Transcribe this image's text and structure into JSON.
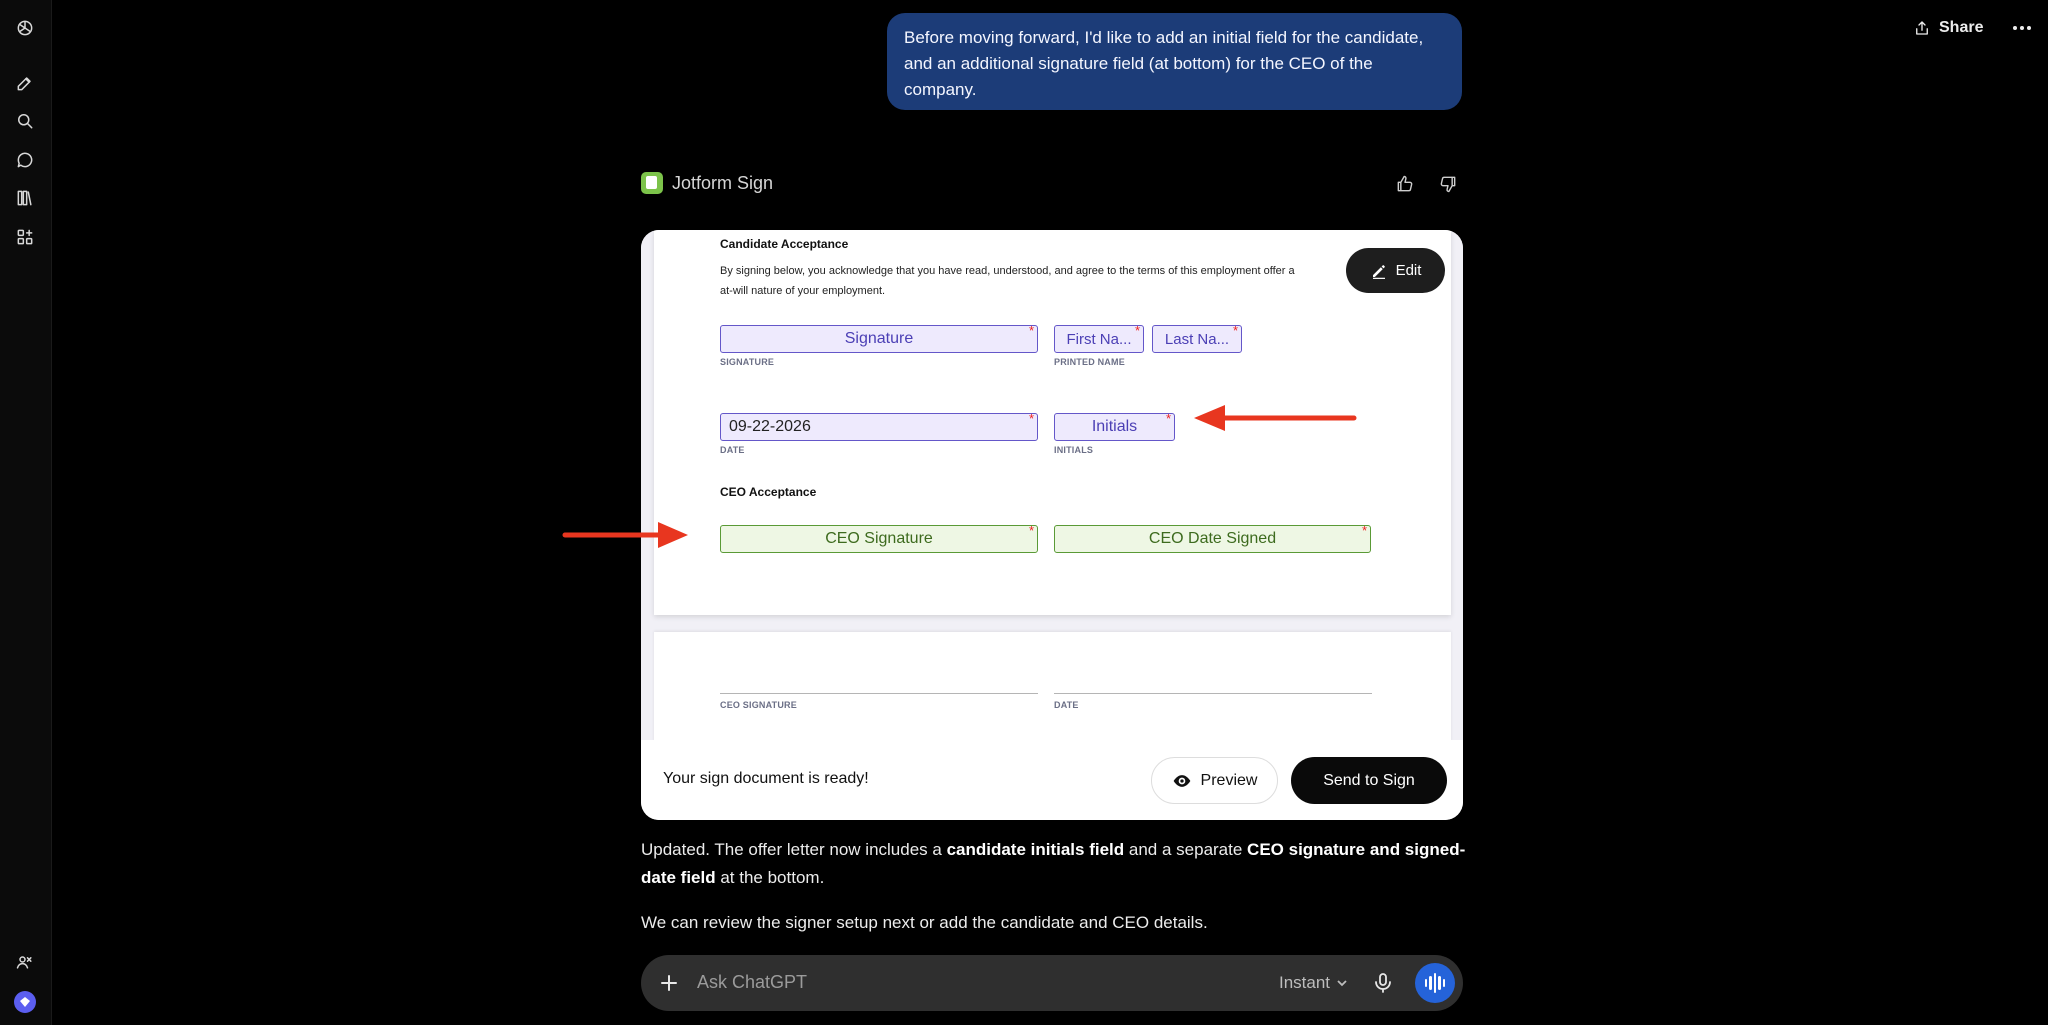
{
  "header": {
    "share_label": "Share"
  },
  "user_message": "Before moving forward, I'd like to add an initial field for the candidate, and an additional signature field (at bottom) for the CEO of the company.",
  "tool": {
    "name": "Jotform Sign",
    "edit_label": "Edit",
    "ready_text": "Your sign document is ready!",
    "preview_label": "Preview",
    "send_label": "Send to Sign"
  },
  "document": {
    "candidate_heading": "Candidate Acceptance",
    "candidate_text": "By signing below, you acknowledge that you have read, understood, and agree to the terms of this employment offer a",
    "candidate_text_2": "at-will nature of your employment.",
    "fields": {
      "signature": "Signature",
      "first_name": "First Na...",
      "last_name": "Last Na...",
      "date_value": "09-22-2026",
      "initials": "Initials",
      "ceo_signature": "CEO Signature",
      "ceo_date_signed": "CEO Date Signed"
    },
    "labels": {
      "signature": "SIGNATURE",
      "printed_name": "PRINTED NAME",
      "date": "DATE",
      "initials": "INITIALS",
      "ceo_signature": "CEO SIGNATURE",
      "date2": "DATE"
    },
    "required_mark": "*",
    "ceo_heading": "CEO Acceptance"
  },
  "response": {
    "p1_a": "Updated. The offer letter now includes a ",
    "p1_b": "candidate initials field",
    "p1_c": " and a separate ",
    "p1_d": "CEO signature and signed-date field",
    "p1_e": " at the bottom.",
    "p2": "We can review the signer setup next or add the candidate and CEO details."
  },
  "composer": {
    "placeholder": "Ask ChatGPT",
    "model_label": "Instant"
  },
  "colors": {
    "user_bubble": "#1c3c78",
    "field_purple": "#6457c9",
    "field_green": "#5a9a36",
    "arrow_red": "#e8361f",
    "voice_button": "#2563d9"
  }
}
